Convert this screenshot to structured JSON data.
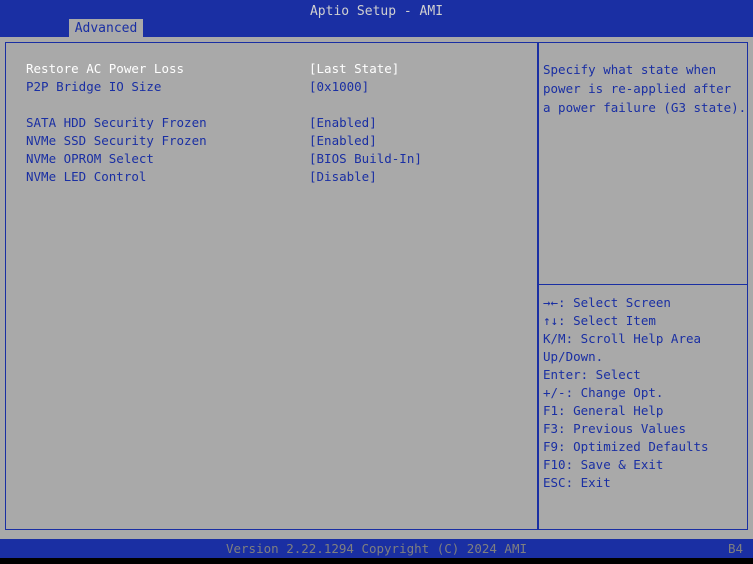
{
  "header": {
    "title": "Aptio Setup - AMI",
    "tab": "Advanced"
  },
  "settings": [
    {
      "label": "Restore AC Power Loss",
      "value": "[Last State]"
    },
    {
      "label": "P2P Bridge IO Size",
      "value": "[0x1000]"
    },
    {
      "label": "SATA HDD Security Frozen",
      "value": "[Enabled]"
    },
    {
      "label": "NVMe SSD Security Frozen",
      "value": "[Enabled]"
    },
    {
      "label": "NVMe OPROM Select",
      "value": "[BIOS Build-In]"
    },
    {
      "label": "NVMe LED Control",
      "value": "[Disable]"
    }
  ],
  "help": {
    "line1": "Specify what state when",
    "line2": "power is re-applied after",
    "line3": "a power failure (G3 state)."
  },
  "keys": [
    "→←: Select Screen",
    "↑↓: Select Item",
    "K/M: Scroll Help Area",
    "Up/Down.",
    "Enter: Select",
    "+/-: Change Opt.",
    "F1: General Help",
    "F3: Previous Values",
    "F9: Optimized Defaults",
    "F10: Save & Exit",
    "ESC: Exit"
  ],
  "footer": {
    "version": "Version 2.22.1294 Copyright (C) 2024 AMI",
    "build": "B4"
  },
  "colors": {
    "bar": "#1a2fa3",
    "background": "#a9a9a9",
    "selected_text": "#ffffff",
    "normal_text": "#1a2fa3"
  }
}
